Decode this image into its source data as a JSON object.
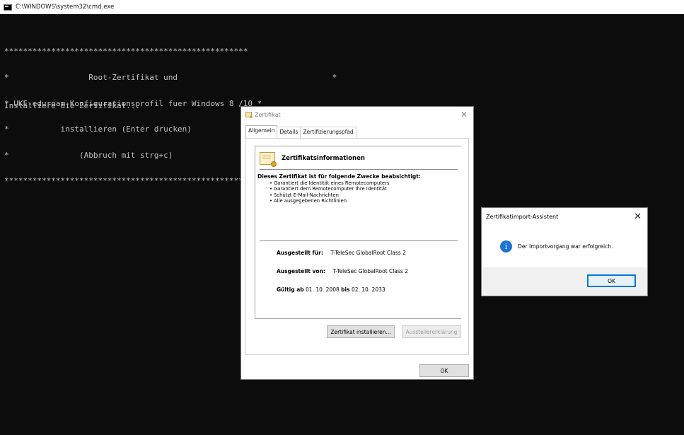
{
  "window": {
    "title": "C:\\WINDOWS\\system32\\cmd.exe",
    "icon": "cmd-icon"
  },
  "console": {
    "lines": [
      "****************************************************",
      "*                 Root-Zertifikat und                                 *",
      "* UKE-eduroam-Konfigurationsprofil fuer Windows 8 /10 *",
      "*           installieren (Enter drucken)               *",
      "*               (Abbruch mit strg+c)                   *",
      "****************************************************"
    ],
    "status_line": "Installiere die Zertifikat..."
  },
  "cert_dialog": {
    "title": "Zertifikat",
    "tabs": [
      "Allgemein",
      "Details",
      "Zertifizierungspfad"
    ],
    "info_title": "Zertifikatsinformationen",
    "purpose_heading": "Dieses Zertifikat ist für folgende Zwecke beabsichtigt:",
    "purposes": [
      "Garantiert die Identität eines Remotecomputers",
      "Garantiert dem Remotecomputer Ihre Identität",
      "Schützt E-Mail-Nachrichten",
      "Alle ausgegebenen Richtlinien"
    ],
    "issued_to_label": "Ausgestellt für:",
    "issued_to": "T-TeleSec GlobalRoot Class 2",
    "issued_by_label": "Ausgestellt von:",
    "issued_by": "T-TeleSec GlobalRoot Class 2",
    "valid_from_label": "Gültig ab",
    "valid_from": "01. 10. 2008",
    "valid_to_label": "bis",
    "valid_to": "02. 10. 2033",
    "install_button": "Zertifikat installieren...",
    "issuer_statement_button": "Ausstellererklärung",
    "ok_button": "OK"
  },
  "wizard_dialog": {
    "title": "Zertifikatimport-Assistent",
    "message": "Der Importvorgang war erfolgreich.",
    "ok_button": "OK"
  }
}
